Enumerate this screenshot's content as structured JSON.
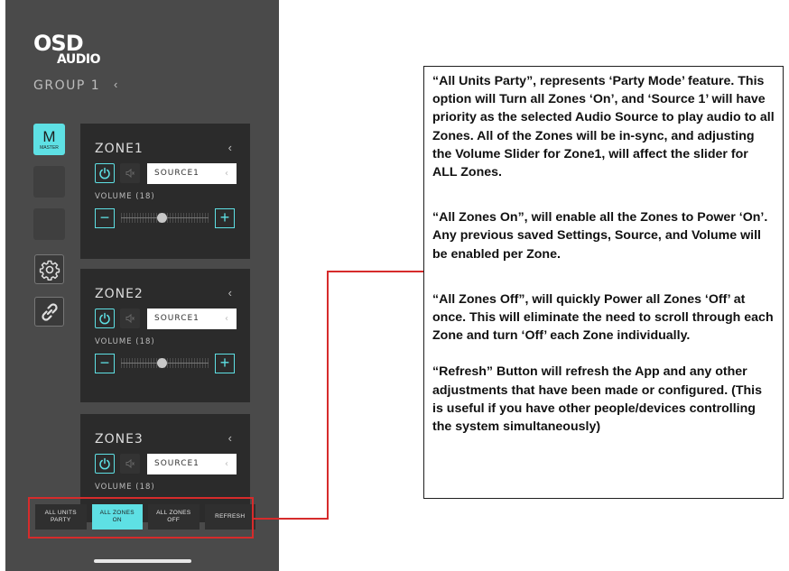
{
  "app": {
    "logo_top": "OSD",
    "logo_bottom": "AUDIO",
    "group_title": "GROUP 1",
    "group_chevron": "‹"
  },
  "sidebar": {
    "master_letter": "M",
    "master_label": "MASTER",
    "icons": [
      "gear-icon",
      "link-icon"
    ]
  },
  "zones": [
    {
      "name": "ZONE1",
      "chevron": "‹",
      "source": "SOURCE1",
      "volume_label": "VOLUME (18)",
      "volume_fraction": 0.46,
      "minus": "−",
      "plus": "+"
    },
    {
      "name": "ZONE2",
      "chevron": "‹",
      "source": "SOURCE1",
      "volume_label": "VOLUME (18)",
      "volume_fraction": 0.46,
      "minus": "−",
      "plus": "+"
    },
    {
      "name": "ZONE3",
      "chevron": "‹",
      "source": "SOURCE1",
      "volume_label": "VOLUME (18)"
    }
  ],
  "bottom_bar": {
    "buttons": [
      {
        "label_line1": "ALL UNITS",
        "label_line2": "PARTY",
        "active": false
      },
      {
        "label_line1": "ALL ZONES",
        "label_line2": "ON",
        "active": true
      },
      {
        "label_line1": "ALL ZONES",
        "label_line2": "OFF",
        "active": false
      },
      {
        "label_line1": "REFRESH",
        "label_line2": "",
        "active": false
      }
    ]
  },
  "description": {
    "party": "“All Units Party”, represents ‘Party Mode’ feature. This option will Turn all Zones ‘On’, and ‘Source 1’ will have priority as the selected Audio Source to play audio to all Zones. All of the Zones will be in-sync, and adjusting the Volume Slider for Zone1, will affect the slider for ALL Zones.",
    "all_on": "“All Zones On”, will enable all the Zones to Power ‘On’. Any previous saved Settings, Source, and Volume will be enabled per Zone.",
    "all_off": "“All Zones Off”, will quickly Power all Zones ‘Off’ at once. This will eliminate the need to scroll through each Zone and turn ‘Off’ each Zone individually.",
    "refresh": "“Refresh” Button will refresh the App and any other adjustments that have been made or configured. (This is useful if you have other people/devices controlling the system simultaneously)"
  },
  "colors": {
    "accent": "#5ee0e4",
    "panel_bg": "#4a4a4a",
    "zone_bg": "#2b2b2b",
    "highlight": "#d62b2b"
  }
}
